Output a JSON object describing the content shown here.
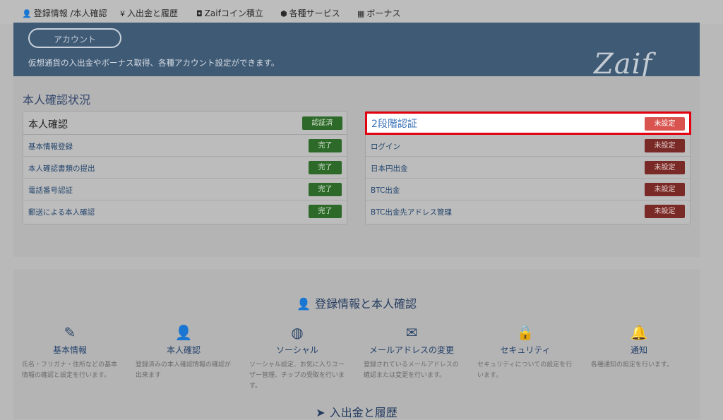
{
  "nav": {
    "items": [
      {
        "icon": "user-icon",
        "glyph": "👤",
        "label": "登録情報 /本人確認"
      },
      {
        "icon": "yen-icon",
        "glyph": "¥",
        "label": "入出金と履歴"
      },
      {
        "icon": "coin-icon",
        "glyph": "◘",
        "label": "Zaifコイン積立"
      },
      {
        "icon": "tags-icon",
        "glyph": "⬢",
        "label": "各種サービス"
      },
      {
        "icon": "gift-icon",
        "glyph": "▦",
        "label": "ボーナス"
      }
    ]
  },
  "banner": {
    "account_button": "アカウント",
    "description": "仮想通貨の入出金やボーナス取得、各種アカウント設定ができます。",
    "logo": "Zaif"
  },
  "status": {
    "title": "本人確認状況",
    "left_card": {
      "header": "本人確認",
      "header_badge": "認証済",
      "rows": [
        {
          "label": "基本情報登録",
          "badge": "完了"
        },
        {
          "label": "本人確認書類の提出",
          "badge": "完了"
        },
        {
          "label": "電話番号認証",
          "badge": "完了"
        },
        {
          "label": "郵送による本人確認",
          "badge": "完了"
        }
      ]
    },
    "right_card": {
      "header": "2段階認証",
      "header_badge": "未設定",
      "rows": [
        {
          "label": "ログイン",
          "badge": "未設定"
        },
        {
          "label": "日本円出金",
          "badge": "未設定"
        },
        {
          "label": "BTC出金",
          "badge": "未設定"
        },
        {
          "label": "BTC出金先アドレス管理",
          "badge": "未設定"
        }
      ]
    }
  },
  "section1": {
    "heading": "登録情報と本人確認",
    "features": [
      {
        "icon": "pencil-icon",
        "glyph": "✎",
        "title": "基本情報",
        "desc": "氏名・フリガナ・住所などの基本情報の確認と設定を行います。"
      },
      {
        "icon": "user-icon",
        "glyph": "👤",
        "title": "本人確認",
        "desc": "登録済みの本人確認情報の確認が出来ます"
      },
      {
        "icon": "globe-icon",
        "glyph": "◍",
        "title": "ソーシャル",
        "desc": "ソーシャル設定、お気に入りユーザー管理、チップの受取を行います。"
      },
      {
        "icon": "envelope-icon",
        "glyph": "✉",
        "title": "メールアドレスの変更",
        "desc": "登録されているメールアドレスの確認または変更を行います。"
      },
      {
        "icon": "lock-icon",
        "glyph": "🔒",
        "title": "セキュリティ",
        "desc": "セキュリティについての設定を行います。"
      },
      {
        "icon": "bell-icon",
        "glyph": "🔔",
        "title": "通知",
        "desc": "各種通知の設定を行います。"
      }
    ]
  },
  "section2": {
    "heading": "入出金と履歴"
  }
}
